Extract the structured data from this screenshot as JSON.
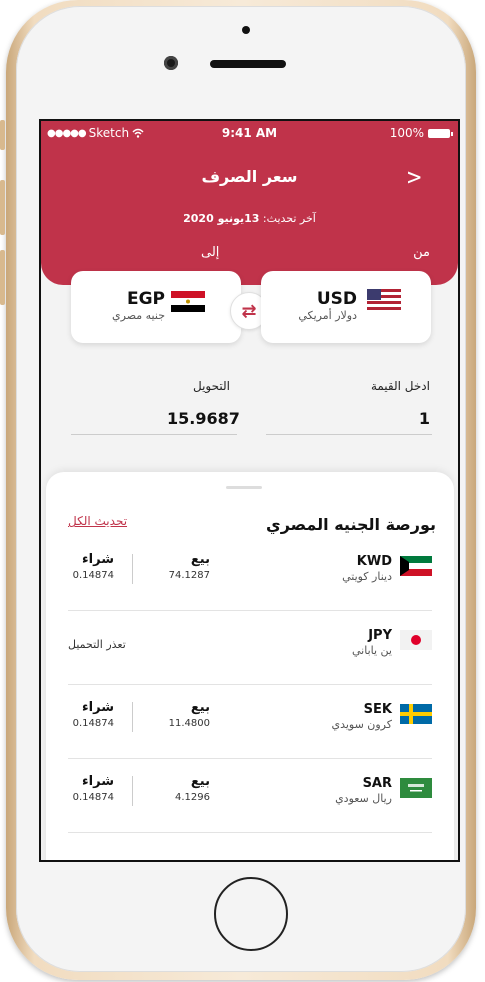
{
  "status_bar": {
    "carrier": "Sketch",
    "time": "9:41 AM",
    "battery": "100%"
  },
  "header": {
    "title": "سعر الصرف",
    "updated_prefix": "آخر تحديث: ",
    "updated_date": "13يونيو 2020",
    "from_label": "من",
    "to_label": "إلى"
  },
  "from_currency": {
    "code": "USD",
    "name": "دولار أمريكي",
    "flag": "us-flag-icon"
  },
  "to_currency": {
    "code": "EGP",
    "name": "جنيه مصري",
    "flag": "eg-flag-icon"
  },
  "converter": {
    "input_label": "ادخل القيمة",
    "input_value": "1",
    "output_label": "التحويل",
    "output_value": "15.9687"
  },
  "sheet": {
    "title": "بورصة الجنيه المصري",
    "refresh_all": "تحديث الكل",
    "rows": [
      {
        "code": "KWD",
        "name": "دينار كويتي",
        "sell_label": "بيع",
        "sell_value": "74.1287",
        "buy_label": "شراء",
        "buy_value": "0.14874"
      },
      {
        "code": "JPY",
        "name": "ين ياباني",
        "status": "تعذر التحميل"
      },
      {
        "code": "SEK",
        "name": "كرون سويدي",
        "sell_label": "بيع",
        "sell_value": "11.4800",
        "buy_label": "شراء",
        "buy_value": "0.14874"
      },
      {
        "code": "SAR",
        "name": "ريال سعودي",
        "sell_label": "بيع",
        "sell_value": "4.1296",
        "buy_label": "شراء",
        "buy_value": "0.14874"
      }
    ]
  },
  "colors": {
    "accent": "#c0334a",
    "background": "#f3f3f3"
  }
}
